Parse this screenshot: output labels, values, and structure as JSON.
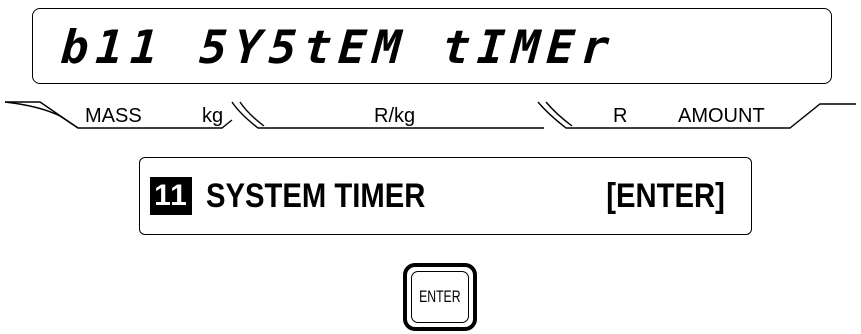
{
  "lcd": {
    "text": "b11 5Y5tEM tIMEr"
  },
  "annunciators": {
    "mass": "MASS",
    "kg": "kg",
    "rate": "R/kg",
    "r": "R",
    "amount": "AMOUNT"
  },
  "message": {
    "number": "11",
    "label": "SYSTEM TIMER",
    "hint": "[ENTER]"
  },
  "key": {
    "label": "ENTER"
  }
}
